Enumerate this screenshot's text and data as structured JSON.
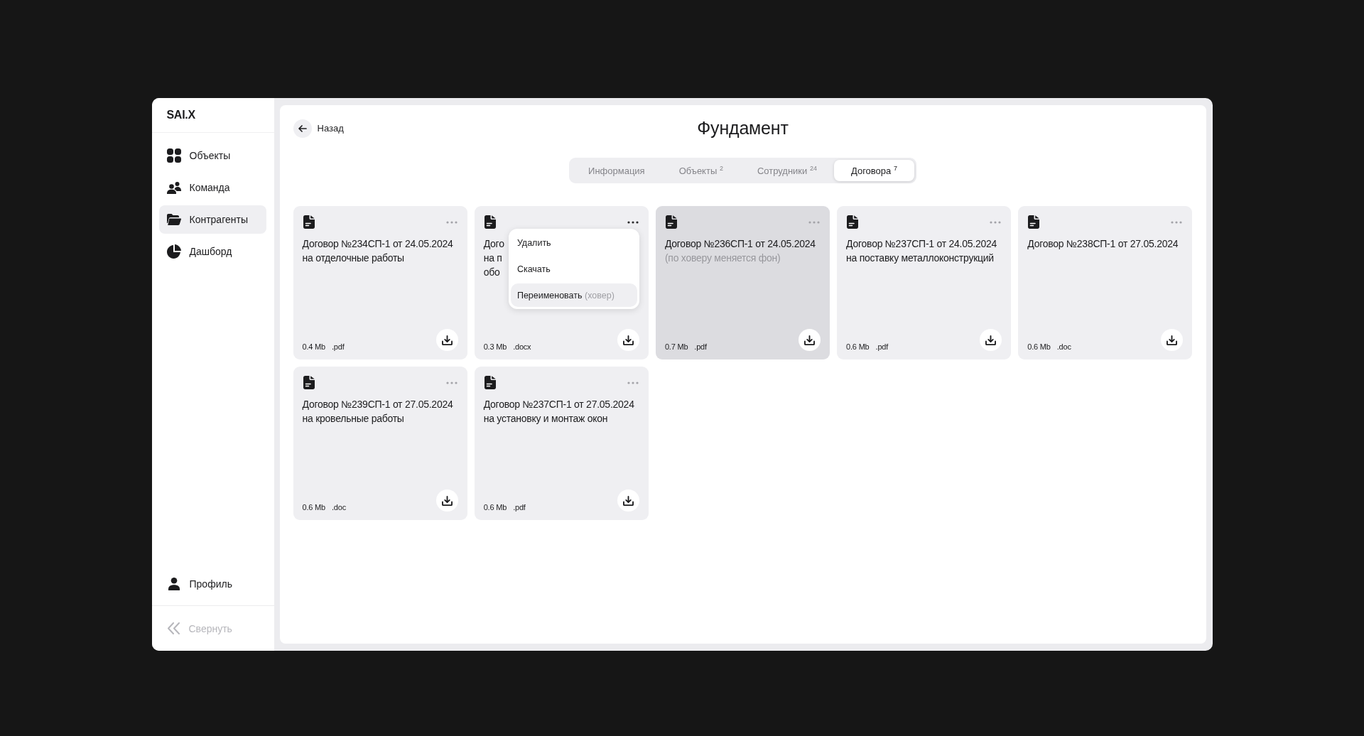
{
  "sidebar": {
    "logo": "SAI.X",
    "nav_items": [
      {
        "label": "Объекты",
        "selected": false
      },
      {
        "label": "Команда",
        "selected": false
      },
      {
        "label": "Контрагенты",
        "selected": true
      },
      {
        "label": "Дашборд",
        "selected": false
      }
    ],
    "profile": {
      "label": "Профиль"
    },
    "collapse": {
      "label": "Свернуть"
    }
  },
  "header": {
    "back": {
      "label": "Назад"
    },
    "title": "Фундамент"
  },
  "tabs": [
    {
      "label": "Информация",
      "selected": false
    },
    {
      "label": "Объекты",
      "count": "2",
      "selected": false
    },
    {
      "label": "Сотрудники",
      "count": "24",
      "selected": false
    },
    {
      "label": "Договора",
      "count": "7",
      "selected": true
    }
  ],
  "contracts": [
    {
      "title_lines": [
        "Договор №234СП-1 от 24.05.2024",
        "на отделочные работы"
      ],
      "size": "0.4 Mb",
      "ext": ".pdf",
      "hovered": false,
      "menu_open": false
    },
    {
      "title_lines": [
        "Дого",
        "на п",
        "обо"
      ],
      "size": "0.3 Mb",
      "ext": ".docx",
      "hovered": false,
      "menu_open": true,
      "menu": [
        {
          "label": "Удалить",
          "hovered": false
        },
        {
          "label": "Скачать",
          "hovered": false
        },
        {
          "label": "Переименовать",
          "note": "(ховер)",
          "hovered": true
        }
      ]
    },
    {
      "title_lines": [
        "Договор №236СП-1 от 24.05.2024"
      ],
      "note": "(по ховеру меняется фон)",
      "size": "0.7 Mb",
      "ext": ".pdf",
      "hovered": true,
      "menu_open": false
    },
    {
      "title_lines": [
        "Договор №237СП-1 от 24.05.2024",
        "на поставку металлоконструкций"
      ],
      "size": "0.6 Mb",
      "ext": ".pdf",
      "hovered": false,
      "menu_open": false
    },
    {
      "title_lines": [
        "Договор №238СП-1 от 27.05.2024"
      ],
      "size": "0.6 Mb",
      "ext": ".doc",
      "hovered": false,
      "menu_open": false
    },
    {
      "title_lines": [
        "Договор №239СП-1 от 27.05.2024",
        "на кровельные работы"
      ],
      "size": "0.6 Mb",
      "ext": ".doc",
      "hovered": false,
      "menu_open": false
    },
    {
      "title_lines": [
        "Договор №237СП-1 от 27.05.2024",
        "на установку и монтаж окон"
      ],
      "size": "0.6 Mb",
      "ext": ".pdf",
      "hovered": false,
      "menu_open": false
    }
  ]
}
